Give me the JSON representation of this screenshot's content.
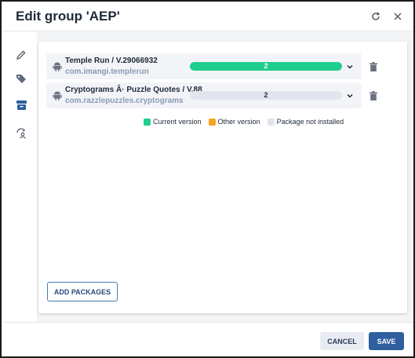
{
  "dialog": {
    "title": "Edit group 'AEP'",
    "refresh_icon": "refresh-icon",
    "close_icon": "close-icon"
  },
  "sidebar": {
    "items": [
      {
        "icon": "pencil-icon",
        "active": false
      },
      {
        "icon": "tags-icon",
        "active": false
      },
      {
        "icon": "archive-icon",
        "active": true
      },
      {
        "icon": "sync-user-icon",
        "active": false
      }
    ]
  },
  "packages": [
    {
      "name": "Temple Run / V.29066932",
      "package_id": "com.imangi.templerun",
      "count": "2",
      "status": "current",
      "fill_fraction": 1.0,
      "platform_icon": "android-icon"
    },
    {
      "name": "Cryptograms Â· Puzzle Quotes / V.88",
      "package_id": "com.razzlepuzzles.cryptograms",
      "count": "2",
      "status": "not_installed",
      "fill_fraction": 0.0,
      "platform_icon": "android-icon"
    }
  ],
  "legend": [
    {
      "label": "Current version",
      "color": "#1fce8f"
    },
    {
      "label": "Other version",
      "color": "#f5a623"
    },
    {
      "label": "Package not installed",
      "color": "#e0e5ee"
    }
  ],
  "actions": {
    "add_packages": "ADD PACKAGES",
    "cancel": "CANCEL",
    "save": "SAVE"
  },
  "colors": {
    "accent": "#2f5f9e",
    "current": "#1fce8f",
    "other": "#f5a623",
    "not_installed": "#e0e5ee",
    "active_sidebar": "#2f5f9e"
  }
}
